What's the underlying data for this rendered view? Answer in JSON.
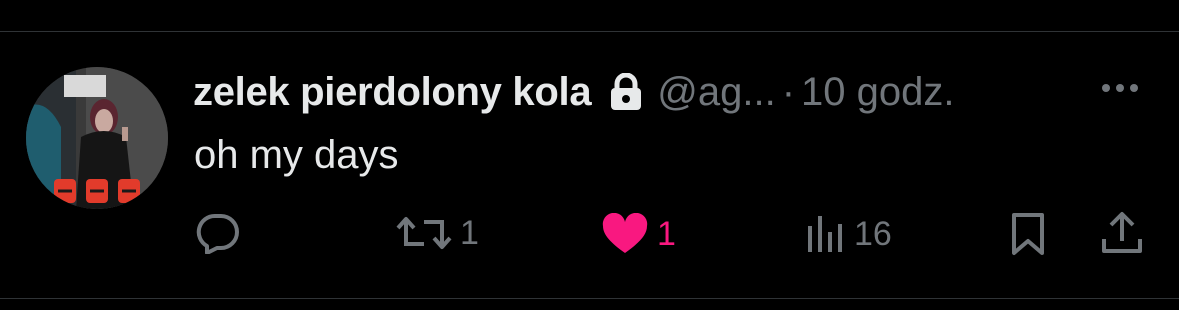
{
  "tweet": {
    "author": {
      "display_name": "zelek pierdolony kola",
      "handle": "@ag...",
      "protected_icon": "lock-icon"
    },
    "time_separator": "·",
    "timestamp": "10 godz.",
    "text": "oh my days",
    "actions": {
      "reply": {
        "icon": "reply-icon"
      },
      "retweet": {
        "icon": "retweet-icon",
        "count": "1"
      },
      "like": {
        "icon": "heart-icon",
        "count": "1",
        "liked": true,
        "color": "#f91880"
      },
      "views": {
        "icon": "views-icon",
        "count": "16"
      },
      "bookmark": {
        "icon": "bookmark-icon"
      },
      "share": {
        "icon": "share-icon"
      }
    }
  },
  "colors": {
    "background": "#000000",
    "primary_text": "#e7e9ea",
    "secondary_text": "#71767b",
    "divider": "#2f3336",
    "like": "#f91880"
  }
}
